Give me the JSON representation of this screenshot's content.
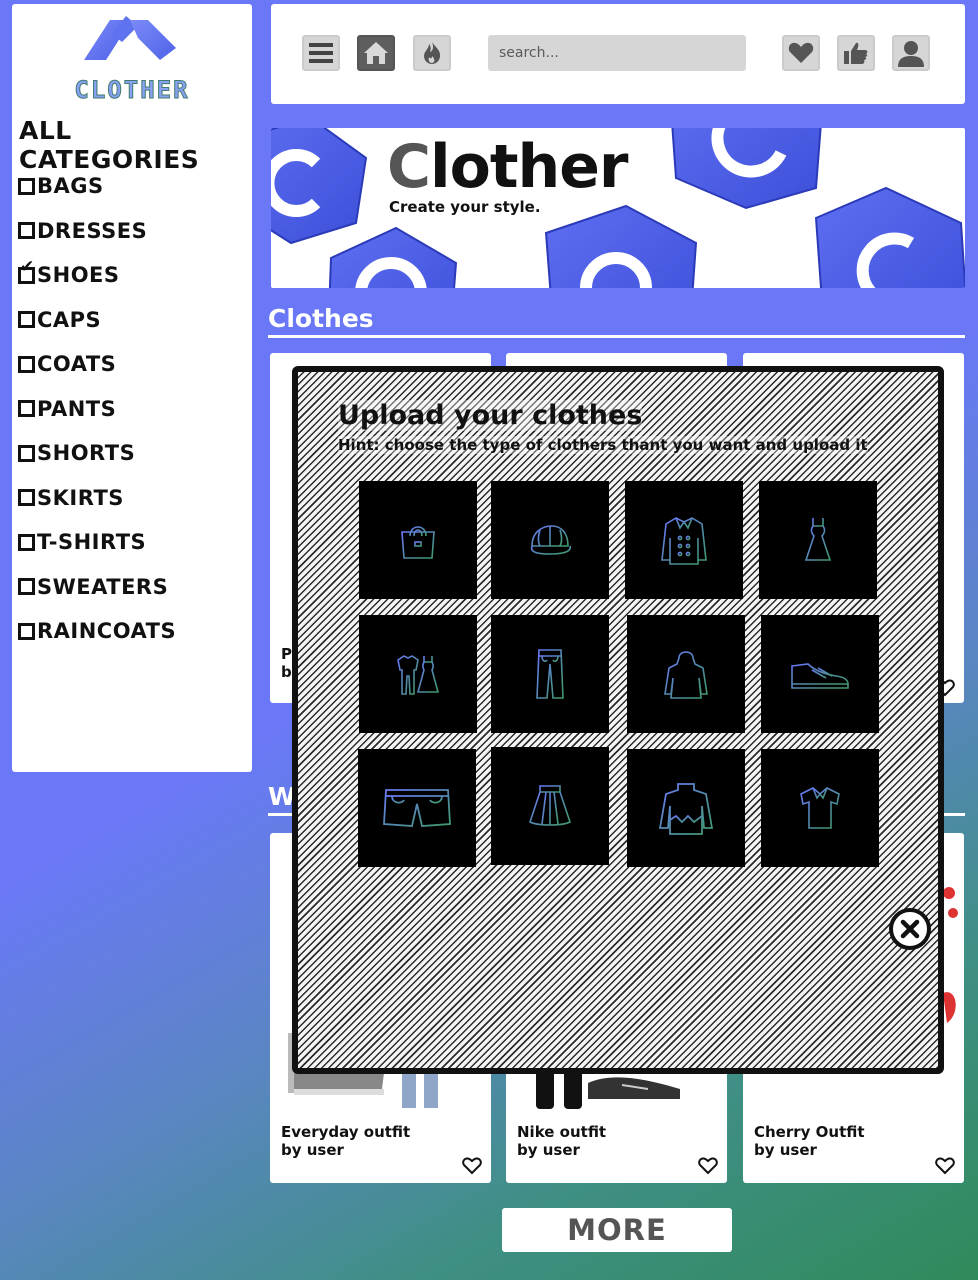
{
  "logo": {
    "text": "CLOTHER"
  },
  "sidebar": {
    "title": "ALL CATEGORIES",
    "categories": [
      {
        "label": "BAGS",
        "checked": false
      },
      {
        "label": "DRESSES",
        "checked": false
      },
      {
        "label": "SHOES",
        "checked": true
      },
      {
        "label": "CAPS",
        "checked": false
      },
      {
        "label": "COATS",
        "checked": false
      },
      {
        "label": "PANTS",
        "checked": false
      },
      {
        "label": "SHORTS",
        "checked": false
      },
      {
        "label": "SKIRTS",
        "checked": false
      },
      {
        "label": "T-SHIRTS",
        "checked": false
      },
      {
        "label": "SWEATERS",
        "checked": false
      },
      {
        "label": "RAINCOATS",
        "checked": false
      }
    ]
  },
  "topbar": {
    "icons": [
      "menu-icon",
      "home-icon",
      "flame-icon",
      "heart-icon",
      "thumbs-up-icon",
      "user-icon"
    ],
    "search_placeholder": "search..."
  },
  "banner": {
    "title_first": "C",
    "title_rest": "lother",
    "subtitle": "Create your style."
  },
  "sections": {
    "clothes": "Clothes",
    "outfits_partial": "W"
  },
  "clothes_cards": [
    {
      "title_partial": "P",
      "author_partial": "b"
    },
    {
      "title_partial": "",
      "author_partial": ""
    },
    {
      "title_partial": "",
      "author_partial": ""
    }
  ],
  "outfit_cards": [
    {
      "title": "Everyday outfit",
      "author": "by user"
    },
    {
      "title": "Nike outfit",
      "author": "by user"
    },
    {
      "title": "Cherry Outfit",
      "author": "by user"
    }
  ],
  "more_label": "MORE",
  "modal": {
    "title": "Upload your clothes",
    "hint": "Hint: choose the type of clothers thant you want and upload it",
    "tiles": [
      "bag-icon",
      "cap-icon",
      "coat-icon",
      "dress-icon",
      "outfit-icon",
      "pants-icon",
      "raincoat-icon",
      "shoe-icon",
      "shorts-icon",
      "skirt-icon",
      "sweater-icon",
      "t-shirt-icon"
    ]
  },
  "colors": {
    "accent": "#6a78f7",
    "icon_gradient_start": "#6a78f7",
    "icon_gradient_end": "#3f9a6a"
  }
}
